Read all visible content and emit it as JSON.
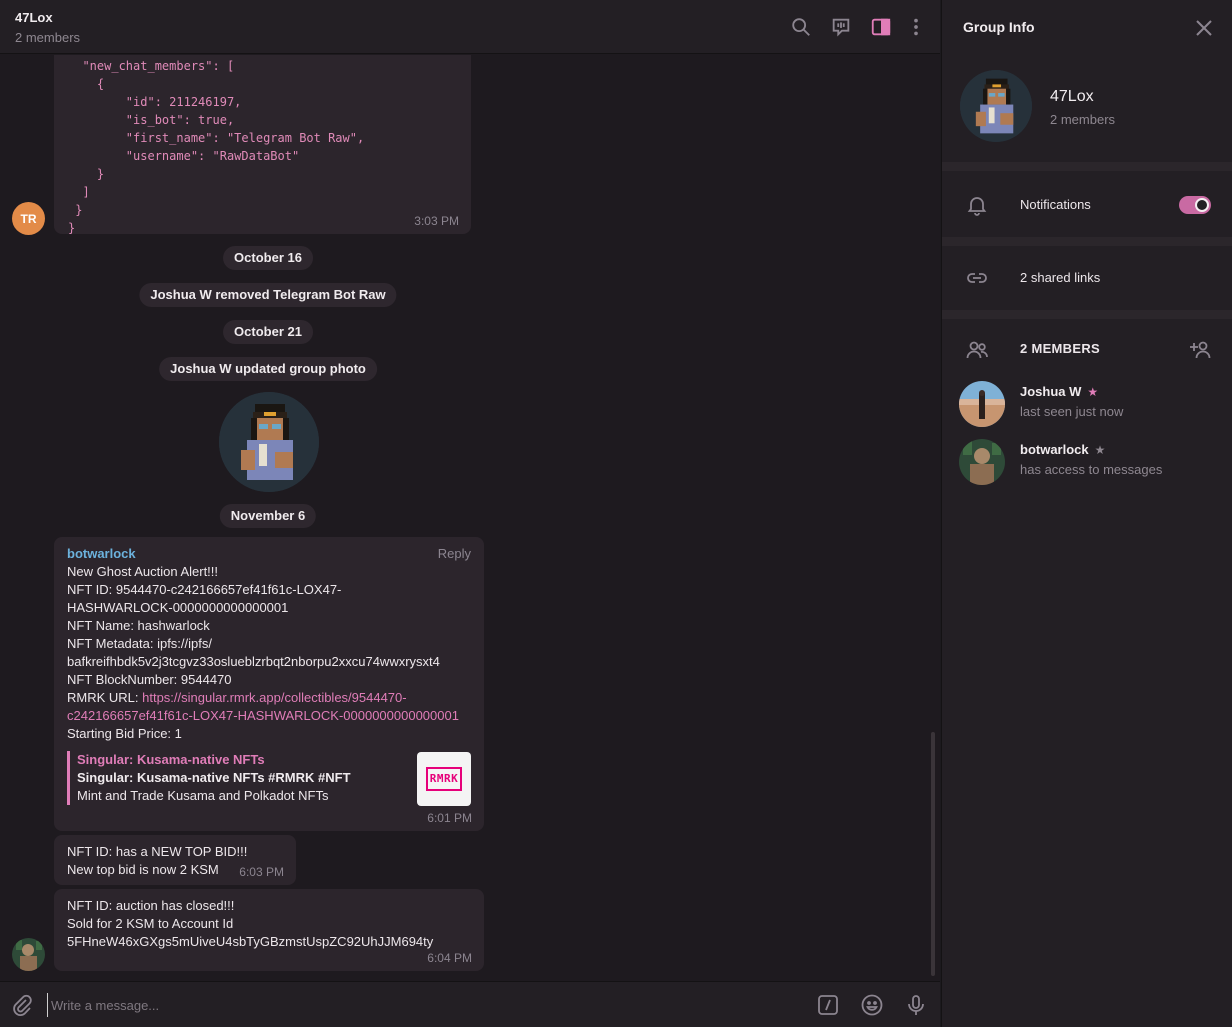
{
  "chat": {
    "title": "47Lox",
    "subtitle": "2 members",
    "code_message": {
      "text": "  \"new_chat_members\": [\n    {\n        \"id\": 211246197,\n        \"is_bot\": true,\n        \"first_name\": \"Telegram Bot Raw\",\n        \"username\": \"RawDataBot\"\n    }\n  ]\n }\n}",
      "time": "3:03 PM",
      "avatar_initials": "TR"
    },
    "service_messages": [
      "October 16",
      "Joshua W removed Telegram Bot Raw",
      "October 21",
      "Joshua W updated group photo",
      "November 6"
    ],
    "bot_message": {
      "sender": "botwarlock",
      "reply_label": "Reply",
      "lines": [
        "New Ghost Auction Alert!!!",
        "NFT ID: 9544470-c242166657ef41f61c-LOX47-",
        "HASHWARLOCK-0000000000000001",
        "NFT Name: hashwarlock",
        "NFT Metadata: ipfs://ipfs/",
        "bafkreifhbdk5v2j3tcgvz33oslueblzrbqt2nborpu2xxcu74wwxrysxt4",
        "NFT BlockNumber: 9544470"
      ],
      "rmrk_label": "RMRK URL: ",
      "rmrk_link_line1": "https://singular.rmrk.app/collectibles/9544470-",
      "rmrk_link_line2": "c242166657ef41f61c-LOX47-HASHWARLOCK-0000000000000001",
      "starting_bid": "Starting Bid Price: 1",
      "preview": {
        "site": "Singular: Kusama-native NFTs",
        "title": "Singular: Kusama-native NFTs #RMRK #NFT",
        "description": "Mint and Trade Kusama and Polkadot NFTs",
        "thumb_text": "RMRK"
      },
      "time": "6:01 PM"
    },
    "bid_message": {
      "line1": "NFT ID:  has a NEW TOP BID!!!",
      "line2": "New top bid is now 2 KSM",
      "time": "6:03 PM"
    },
    "closed_message": {
      "line1": "NFT ID:  auction has closed!!!",
      "line2": "Sold for 2 KSM to Account Id",
      "line3": "5FHneW46xGXgs5mUiveU4sbTyGBzmstUspZC92UhJJM694ty",
      "time": "6:04 PM"
    },
    "composer": {
      "placeholder": "Write a message..."
    }
  },
  "info": {
    "title": "Group Info",
    "name": "47Lox",
    "members_count": "2 members",
    "notifications_label": "Notifications",
    "notifications_on": true,
    "shared_links": "2 shared links",
    "members_header": "2 MEMBERS",
    "members": [
      {
        "name": "Joshua W",
        "status": "last seen just now",
        "star_color": "#e07db8"
      },
      {
        "name": "botwarlock",
        "status": "has access to messages",
        "star_color": "#8e8790"
      }
    ]
  },
  "icons": {
    "header": [
      "search-icon",
      "video-chat-icon",
      "sidebar-toggle-icon",
      "more-icon"
    ],
    "composer": [
      "attach-icon",
      "commands-icon",
      "emoji-icon",
      "microphone-icon"
    ]
  },
  "colors": {
    "accent": "#e07db8",
    "sender": "#6cb2dd",
    "tr_avatar": "#e38b48"
  }
}
